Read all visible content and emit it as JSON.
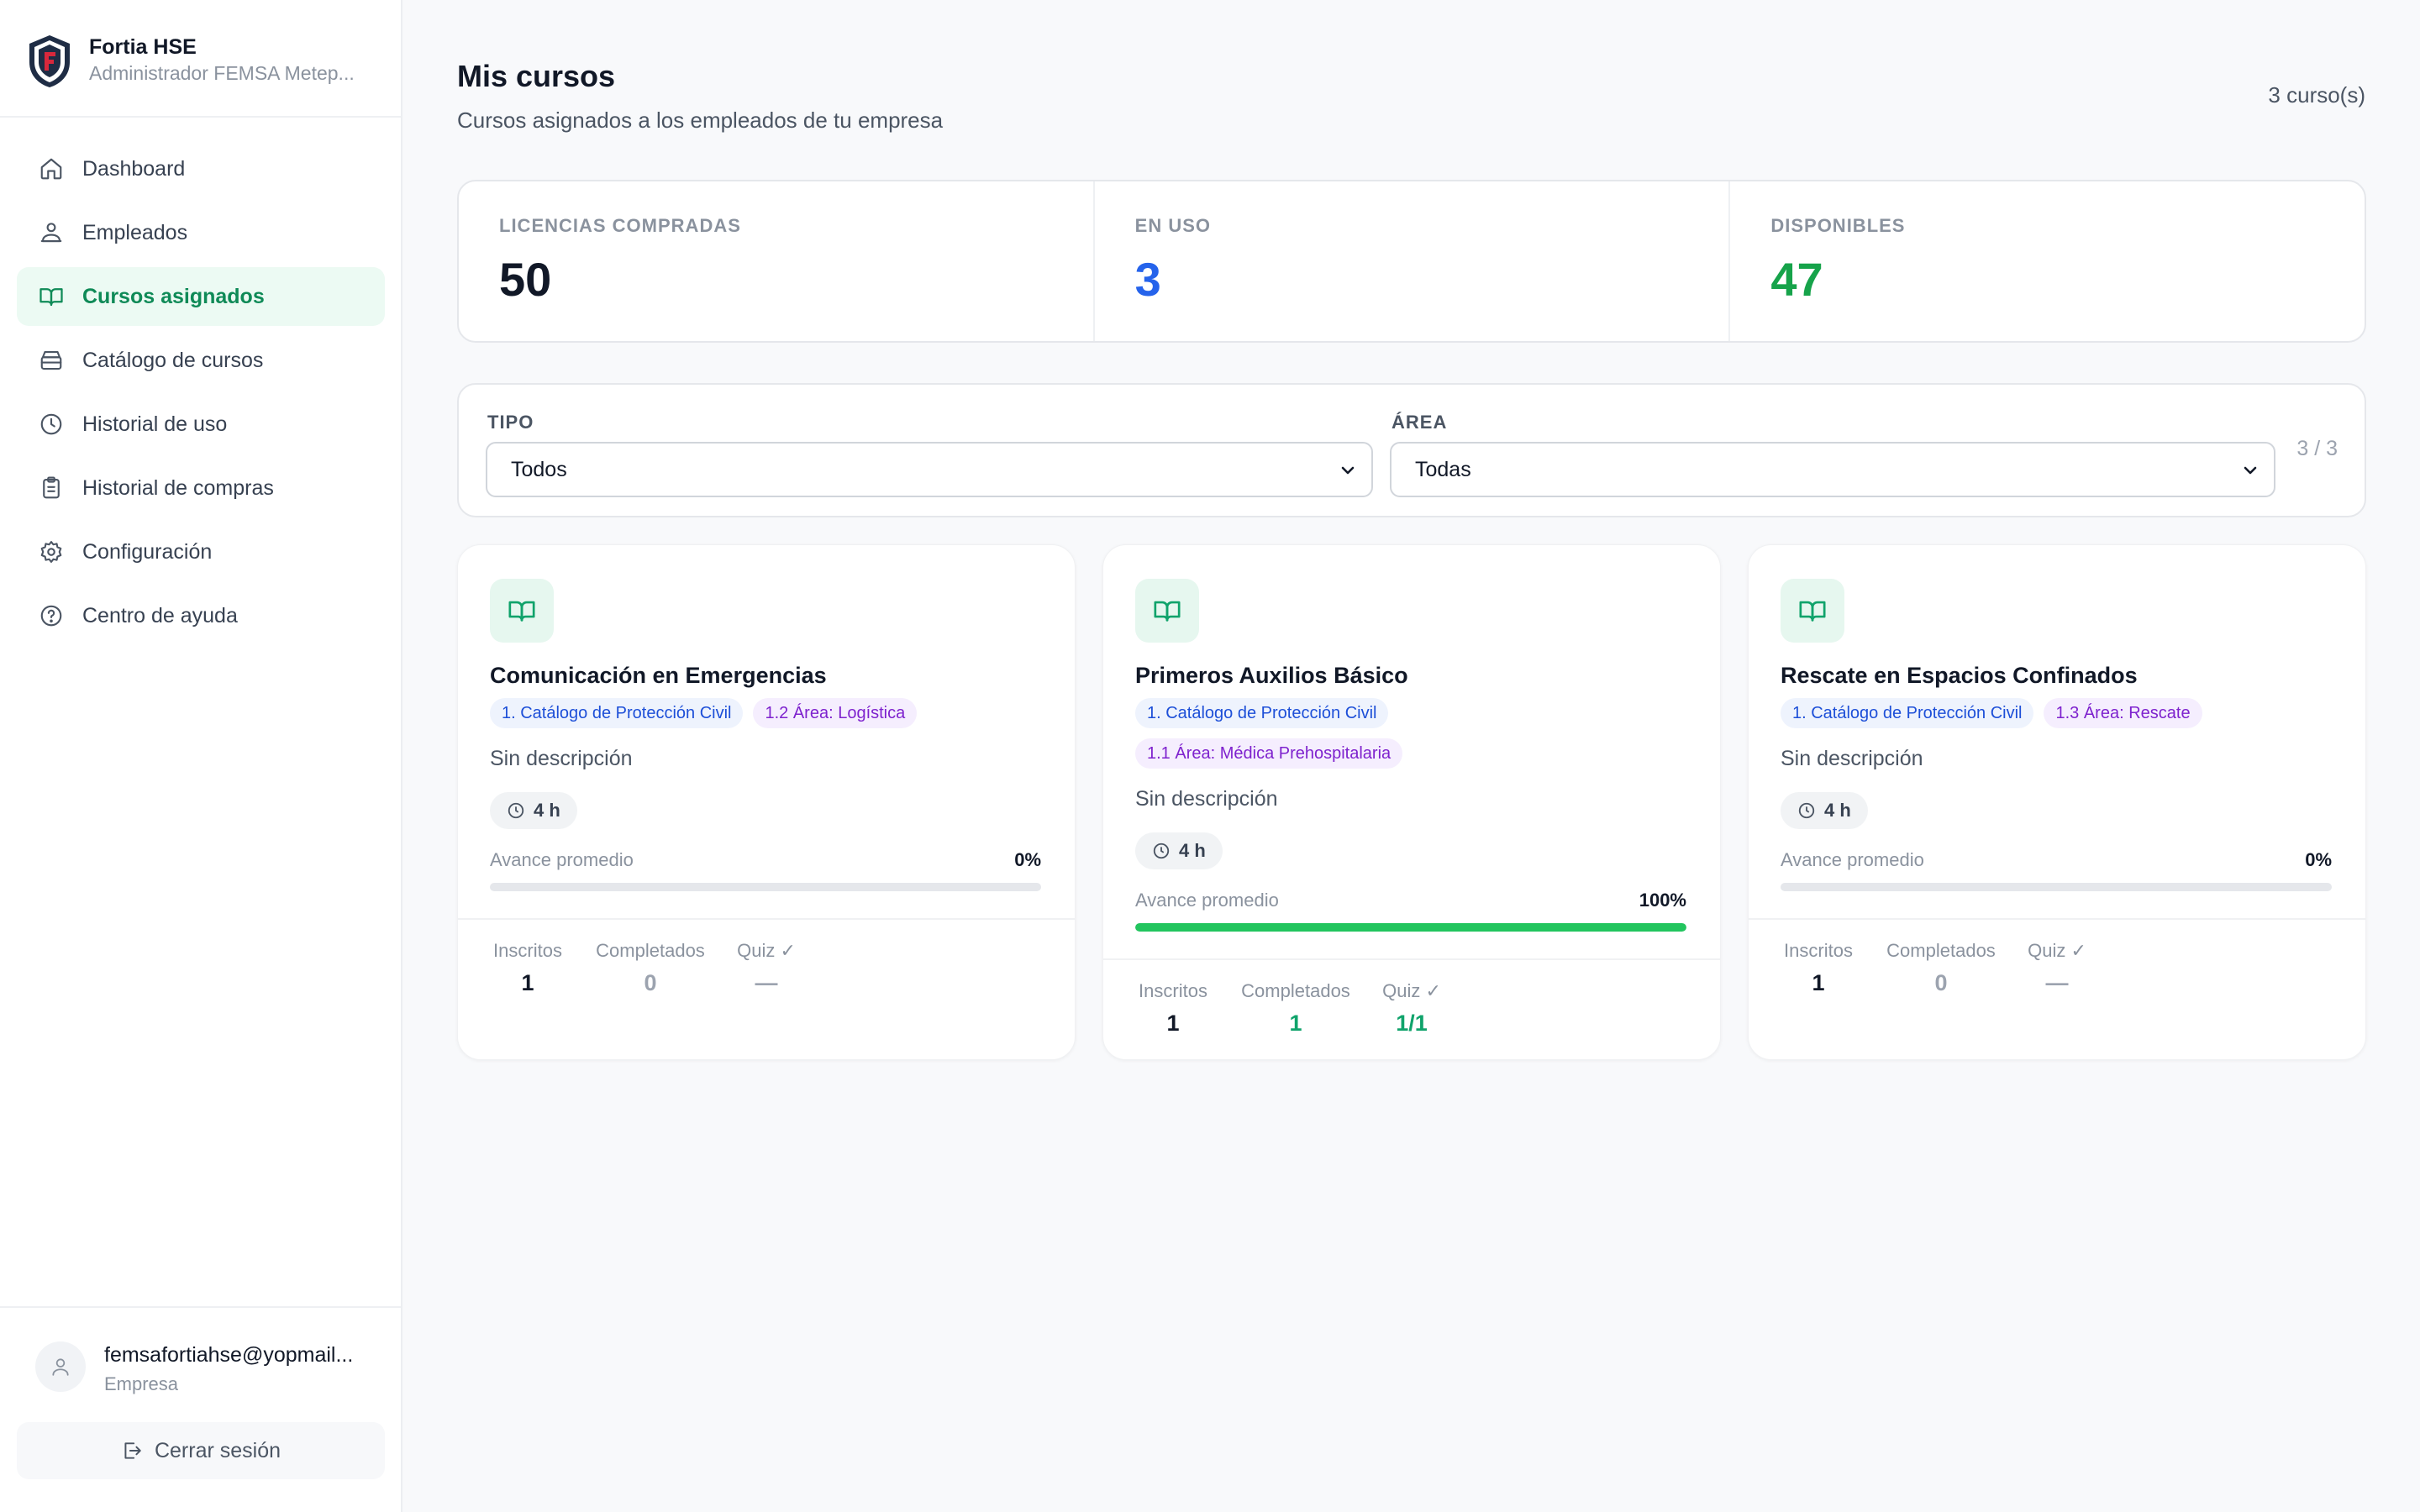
{
  "brand": {
    "name": "Fortia HSE",
    "subtitle": "Administrador FEMSA Metep..."
  },
  "nav": [
    {
      "label": "Dashboard",
      "icon": "home-icon",
      "active": false
    },
    {
      "label": "Empleados",
      "icon": "users-icon",
      "active": false
    },
    {
      "label": "Cursos asignados",
      "icon": "book-open-icon",
      "active": true
    },
    {
      "label": "Catálogo de cursos",
      "icon": "catalog-icon",
      "active": false
    },
    {
      "label": "Historial de uso",
      "icon": "clock-icon",
      "active": false
    },
    {
      "label": "Historial de compras",
      "icon": "clipboard-icon",
      "active": false
    },
    {
      "label": "Configuración",
      "icon": "gear-icon",
      "active": false
    },
    {
      "label": "Centro de ayuda",
      "icon": "help-icon",
      "active": false
    }
  ],
  "user": {
    "email": "femsafortiahse@yopmail...",
    "role": "Empresa",
    "logout_label": "Cerrar sesión"
  },
  "header": {
    "title": "Mis cursos",
    "subtitle": "Cursos asignados a los empleados de tu empresa",
    "count": "3 curso(s)"
  },
  "stats": [
    {
      "label": "LICENCIAS COMPRADAS",
      "value": "50",
      "color": "#111827"
    },
    {
      "label": "EN USO",
      "value": "3",
      "color": "#2563eb"
    },
    {
      "label": "DISPONIBLES",
      "value": "47",
      "color": "#16a34a"
    }
  ],
  "filters": {
    "tipo_label": "TIPO",
    "tipo_value": "Todos",
    "area_label": "ÁREA",
    "area_value": "Todas",
    "count": "3 / 3"
  },
  "progress_label": "Avance promedio",
  "metric_labels": {
    "enrolled": "Inscritos",
    "completed": "Completados",
    "quiz": "Quiz ✓"
  },
  "courses": [
    {
      "title": "Comunicación en Emergencias",
      "tags": [
        "1. Catálogo de Protección Civil",
        "1.2 Área: Logística"
      ],
      "description": "Sin descripción",
      "duration": "4 h",
      "progress": "0%",
      "progress_fraction": 0,
      "enrolled": "1",
      "completed": "0",
      "quiz": "—"
    },
    {
      "title": "Primeros Auxilios Básico",
      "tags": [
        "1. Catálogo de Protección Civil",
        "1.1 Área: Médica Prehospitalaria"
      ],
      "description": "Sin descripción",
      "duration": "4 h",
      "progress": "100%",
      "progress_fraction": 1,
      "enrolled": "1",
      "completed": "1",
      "quiz": "1/1"
    },
    {
      "title": "Rescate en Espacios Confinados",
      "tags": [
        "1. Catálogo de Protección Civil",
        "1.3 Área: Rescate"
      ],
      "description": "Sin descripción",
      "duration": "4 h",
      "progress": "0%",
      "progress_fraction": 0,
      "enrolled": "1",
      "completed": "0",
      "quiz": "—"
    }
  ]
}
